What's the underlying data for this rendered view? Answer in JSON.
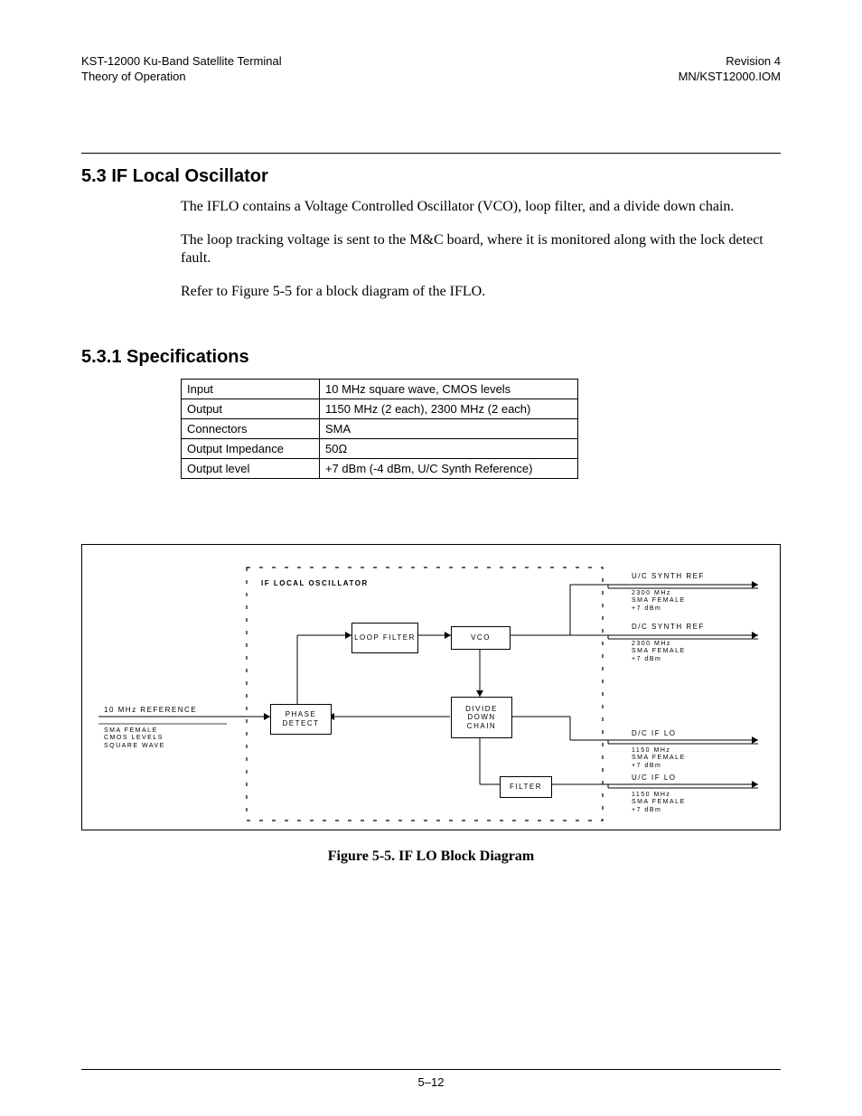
{
  "header": {
    "left_line1": "KST-12000 Ku-Band Satellite Terminal",
    "left_line2": "Theory of Operation",
    "right_line1": "Revision 4",
    "right_line2": "MN/KST12000.IOM"
  },
  "section": {
    "number_title": "5.3  IF Local Oscillator",
    "paragraphs": [
      "The IFLO contains a Voltage Controlled Oscillator (VCO), loop filter, and a divide down chain.",
      "The loop tracking voltage is sent to the M&C board, where it is monitored along with the lock detect fault.",
      "Refer to Figure 5-5 for a block diagram of the IFLO."
    ]
  },
  "subsection": {
    "number_title": "5.3.1  Specifications",
    "table_rows": [
      {
        "k": "Input",
        "v": "10 MHz square wave, CMOS levels"
      },
      {
        "k": "Output",
        "v": "1150 MHz (2 each), 2300 MHz (2 each)"
      },
      {
        "k": "Connectors",
        "v": "SMA"
      },
      {
        "k": "Output Impedance",
        "v": "50Ω"
      },
      {
        "k": "Output level",
        "v": "+7 dBm (-4 dBm, U/C Synth Reference)"
      }
    ]
  },
  "diagram": {
    "title": "IF LOCAL OSCILLATOR",
    "blocks": {
      "loop_filter": "LOOP\nFILTER",
      "vco": "VCO",
      "phase_detect": "PHASE\nDETECT",
      "divide_down": "DIVIDE\nDOWN\nCHAIN",
      "filter": "FILTER"
    },
    "input": {
      "name": "10 MHz REFERENCE",
      "sub": "SMA FEMALE\nCMOS LEVELS\nSQUARE WAVE"
    },
    "outputs": [
      {
        "name": "U/C SYNTH REF",
        "sub": "2300 MHz\nSMA FEMALE\n+7 dBm"
      },
      {
        "name": "D/C SYNTH REF",
        "sub": "2300 MHz\nSMA FEMALE\n+7 dBm"
      },
      {
        "name": "D/C IF LO",
        "sub": "1150 MHz\nSMA FEMALE\n+7 dBm"
      },
      {
        "name": "U/C IF LO",
        "sub": "1150 MHz\nSMA FEMALE\n+7 dBm"
      }
    ],
    "caption": "Figure 5-5.  IF LO Block Diagram"
  },
  "footer": {
    "page": "5–12"
  }
}
